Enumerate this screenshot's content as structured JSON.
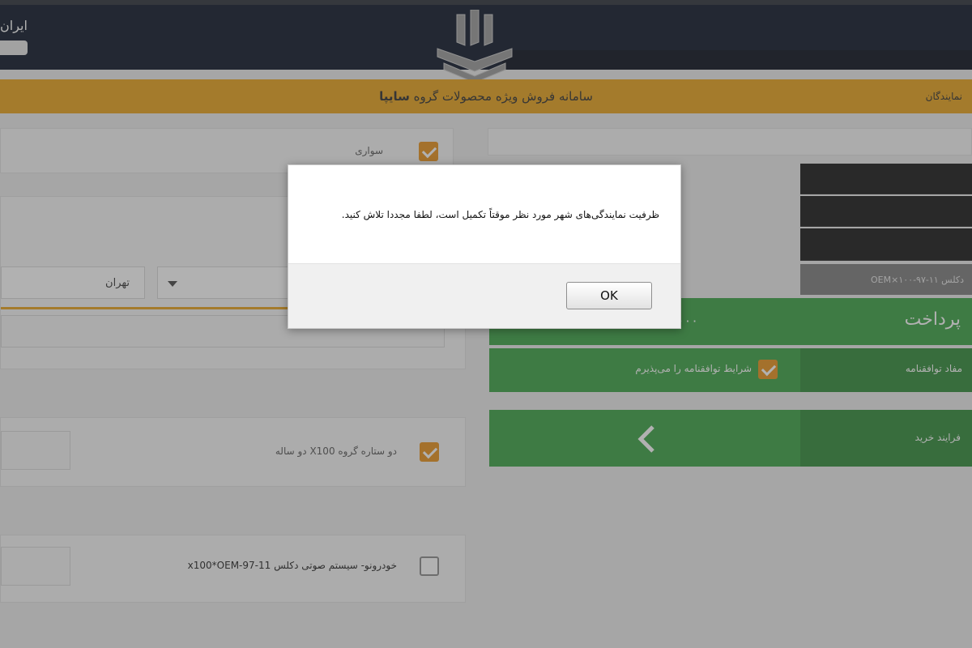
{
  "header": {
    "brand_left": "ایران",
    "title_prefix": "سامانه فروش ویژه محصولات گروه",
    "title_brand": "سایپا",
    "right_text": "نمایندگان"
  },
  "form": {
    "top_checkbox_label": "سواری",
    "city_value": "تهران",
    "option_1_label": "دو ستاره گروه X100 دو ساله",
    "option_2_label": "خودرونو- سیستم صوتی دکلس x100*OEM-97-11"
  },
  "payment": {
    "field_value": "دکلس ۱۱-۹۷-OEM×۱۰۰",
    "pay_title": "پرداخت",
    "pay_amount": "۰۰۰",
    "terms_label": "مفاد توافقنامه",
    "terms_accept": "شرایط توافقنامه را می‌پذیرم",
    "process_label": "فرایند خرید"
  },
  "dialog": {
    "message": "ظرفیت نمایندگی‌های شهر مورد نظر  موقتاً تکمیل است، لطفا مجددا تلاش کنید.",
    "ok_label": "OK"
  },
  "colors": {
    "header": "#0b1426",
    "accent_orange": "#e9a21a",
    "green": "#3aa344"
  }
}
